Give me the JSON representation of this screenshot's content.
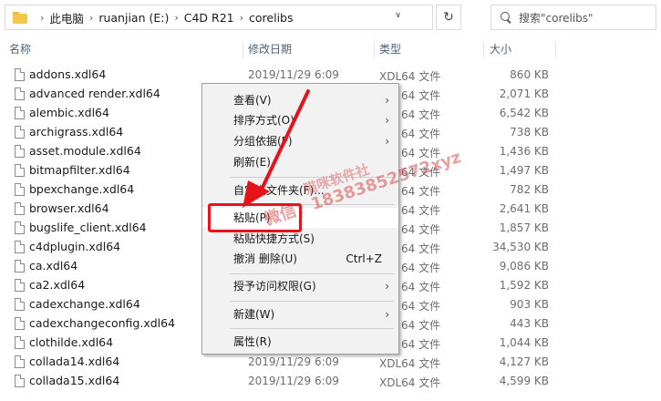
{
  "address_bar": {
    "crumbs": [
      "此电脑",
      "ruanjian (E:)",
      "C4D R21",
      "corelibs"
    ],
    "search_placeholder": "搜索\"corelibs\""
  },
  "columns": {
    "name": "名称",
    "date": "修改日期",
    "type": "类型",
    "size": "大小"
  },
  "files": [
    {
      "name": "addons.xdl64",
      "date": "2019/11/29 6:09",
      "type": "XDL64 文件",
      "size": "860 KB"
    },
    {
      "name": "advanced render.xdl64",
      "date": "",
      "type": "64 文件",
      "size": "2,071 KB"
    },
    {
      "name": "alembic.xdl64",
      "date": "",
      "type": "64 文件",
      "size": "6,542 KB"
    },
    {
      "name": "archigrass.xdl64",
      "date": "",
      "type": "64 文件",
      "size": "738 KB"
    },
    {
      "name": "asset.module.xdl64",
      "date": "",
      "type": "64 文件",
      "size": "1,436 KB"
    },
    {
      "name": "bitmapfilter.xdl64",
      "date": "",
      "type": "64 文件",
      "size": "1,497 KB"
    },
    {
      "name": "bpexchange.xdl64",
      "date": "",
      "type": "64 文件",
      "size": "782 KB"
    },
    {
      "name": "browser.xdl64",
      "date": "",
      "type": "64 文件",
      "size": "2,641 KB"
    },
    {
      "name": "bugslife_client.xdl64",
      "date": "",
      "type": "64 文件",
      "size": "1,857 KB"
    },
    {
      "name": "c4dplugin.xdl64",
      "date": "",
      "type": "64 文件",
      "size": "34,530 KB"
    },
    {
      "name": "ca.xdl64",
      "date": "",
      "type": "64 文件",
      "size": "9,086 KB"
    },
    {
      "name": "ca2.xdl64",
      "date": "",
      "type": "64 文件",
      "size": "1,592 KB"
    },
    {
      "name": "cadexchange.xdl64",
      "date": "",
      "type": "64 文件",
      "size": "903 KB"
    },
    {
      "name": "cadexchangeconfig.xdl64",
      "date": "",
      "type": "64 文件",
      "size": "443 KB"
    },
    {
      "name": "clothilde.xdl64",
      "date": "",
      "type": "64 文件",
      "size": "1,044 KB"
    },
    {
      "name": "collada14.xdl64",
      "date": "2019/11/29 6:09",
      "type": "XDL64 文件",
      "size": "4,127 KB"
    },
    {
      "name": "collada15.xdl64",
      "date": "2019/11/29 6:09",
      "type": "XDL64 文件",
      "size": "4,599 KB"
    }
  ],
  "context_menu": {
    "view": "查看(V)",
    "sort": "排序方式(O)",
    "group": "分组依据(P)",
    "refresh": "刷新(E)",
    "customize": "自定义文件夹(F)...",
    "paste": "粘贴(P)",
    "paste_shortcut": "粘贴快捷方式(S)",
    "undo_delete": "撤消 删除(U)",
    "undo_shortcut": "Ctrl+Z",
    "give_access": "授予访问权限(G)",
    "new": "新建(W)",
    "properties": "属性(R)"
  },
  "watermark": {
    "line1": "猫咪软件社",
    "line2": "微信：18383852572xyz"
  },
  "colors": {
    "highlight_box": "#e8121a",
    "menu_bg": "#f2f2f2",
    "header_text": "#4c607a"
  }
}
